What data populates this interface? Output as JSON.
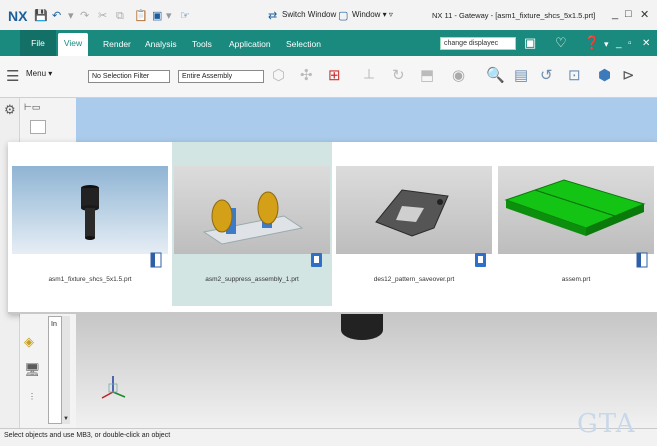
{
  "app": {
    "logo": "NX",
    "title": "NX 11 - Gateway - [asm1_fixture_shcs_5x1.5.prt]",
    "switch_window": "Switch Window",
    "window_menu": "Window ▾ ▿"
  },
  "window_controls": [
    "_",
    "□",
    "✕"
  ],
  "ribbon": {
    "tabs": [
      "File",
      "View",
      "Render",
      "Analysis",
      "Tools",
      "Application",
      "Selection"
    ],
    "active_tab": "View",
    "command_search": "change displayec"
  },
  "toolbar": {
    "menu_label": "Menu ▾",
    "selection_filter": "No Selection Filter",
    "assembly_scope": "Entire Assembly"
  },
  "thumbnails": [
    {
      "label": "asm1_fixture_shcs_5x1.5.prt",
      "selected": false
    },
    {
      "label": "asm2_suppress_assembly_1.prt",
      "selected": true
    },
    {
      "label": "des12_pattern_saveover.prt",
      "selected": false
    },
    {
      "label": "assem.prt",
      "selected": false
    }
  ],
  "side_field": "In",
  "status": {
    "text": "Select objects and use MB3, or double-click an object"
  },
  "watermark": "GTA",
  "colors": {
    "ribbon": "#1a8a7e",
    "selected_card": "#d2e5e3",
    "blue_area": "#aacbeb",
    "green_part": "#14c414"
  }
}
